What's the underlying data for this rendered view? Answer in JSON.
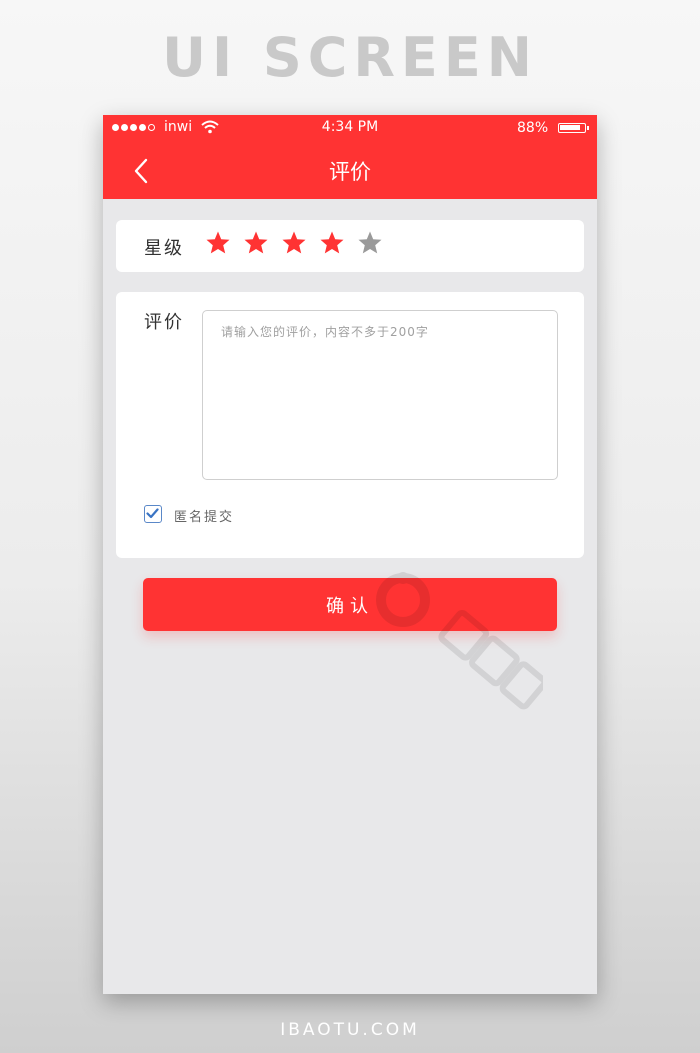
{
  "banner": {
    "title": "UI SCREEN"
  },
  "footer": {
    "brand": "IBAOTU.COM"
  },
  "status_bar": {
    "signal_dots_filled": 4,
    "signal_dots_total": 5,
    "carrier": "inwi",
    "wifi_icon": "wifi-icon",
    "time": "4:34 PM",
    "battery": "88%",
    "battery_level": 0.88
  },
  "nav": {
    "back_icon": "chevron-left-icon",
    "title": "评价"
  },
  "rating": {
    "label": "星级",
    "value": 4,
    "max": 5,
    "active_color": "#ff3333",
    "inactive_color": "#9a9a9a"
  },
  "review": {
    "label": "评价",
    "placeholder": "请输入您的评价，内容不多于200字",
    "value": ""
  },
  "anonymous": {
    "checked": true,
    "label": "匿名提交"
  },
  "confirm_button": {
    "label": "确认"
  },
  "colors": {
    "accent": "#ff3333",
    "background": "#e8e8ea",
    "checkbox": "#5a88c8"
  }
}
